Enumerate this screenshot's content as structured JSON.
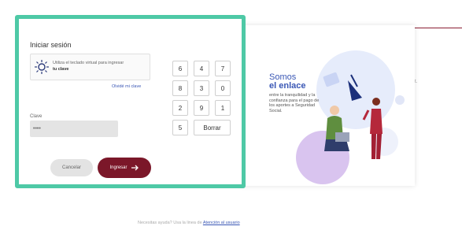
{
  "login": {
    "title": "Iniciar sesión",
    "hint_text": "Utiliza el teclado virtual para ingresar",
    "hint_bold": "tu clave",
    "forgot_link": "Olvidé mi clave",
    "clave_label": "Clave",
    "clave_value": "••••",
    "cancel_label": "Cancelar",
    "submit_label": "Ingresar"
  },
  "keypad": {
    "rows": [
      [
        "6",
        "4",
        "7"
      ],
      [
        "8",
        "3",
        "0"
      ],
      [
        "2",
        "9",
        "1"
      ],
      [
        "5",
        "Borrar"
      ]
    ]
  },
  "promo": {
    "line1": "Somos",
    "line2": "el enlace",
    "line3": "entre la tranquilidad y la confianza para el pago de los aportes a Seguridad Social."
  },
  "footer": {
    "text": "Necesitas ayuda? Usa la linea de",
    "link": "Atención al usuario"
  },
  "colors": {
    "accent_border": "#4ec9a6",
    "primary_button": "#7b1729",
    "link": "#3a57b5"
  },
  "icons": [
    "sun-icon",
    "arrow-right-icon"
  ]
}
